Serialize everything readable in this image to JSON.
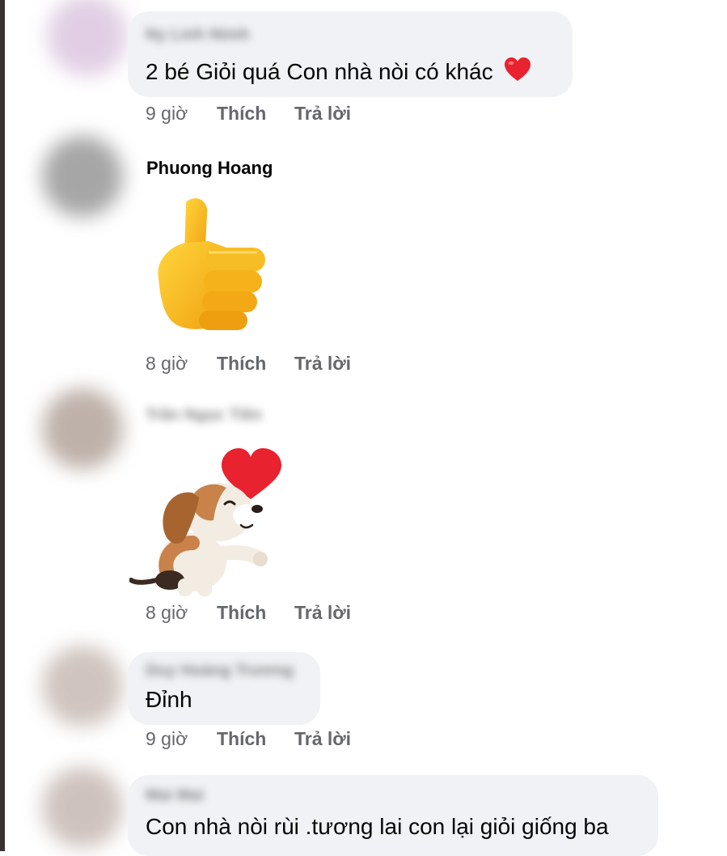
{
  "comments": [
    {
      "author": "Ny Linh Nimh",
      "text": "2 bé Giỏi quá Con nhà nòi có khác",
      "emoji_icon": "red-heart-icon",
      "time": "9 giờ",
      "like": "Thích",
      "reply": "Trả lời"
    },
    {
      "author": "Phuong Hoang",
      "sticker_icon": "thumbs-up-icon",
      "time": "8 giờ",
      "like": "Thích",
      "reply": "Trả lời"
    },
    {
      "author": "Trần Ngọc Tiên",
      "sticker_icon": "puppy-heart-sticker",
      "time": "8 giờ",
      "like": "Thích",
      "reply": "Trả lời"
    },
    {
      "author": "Duy Hoàng Trương",
      "text": "Đỉnh",
      "time": "9 giờ",
      "like": "Thích",
      "reply": "Trả lời"
    },
    {
      "author": "Mai Mai",
      "text": "Con nhà nòi rùi .tương lai con lại giỏi giống ba"
    }
  ],
  "colors": {
    "bubble": "#f0f2f5",
    "meta": "#65676b",
    "heart": "#e8222e",
    "thumb": "#f5b21a"
  }
}
